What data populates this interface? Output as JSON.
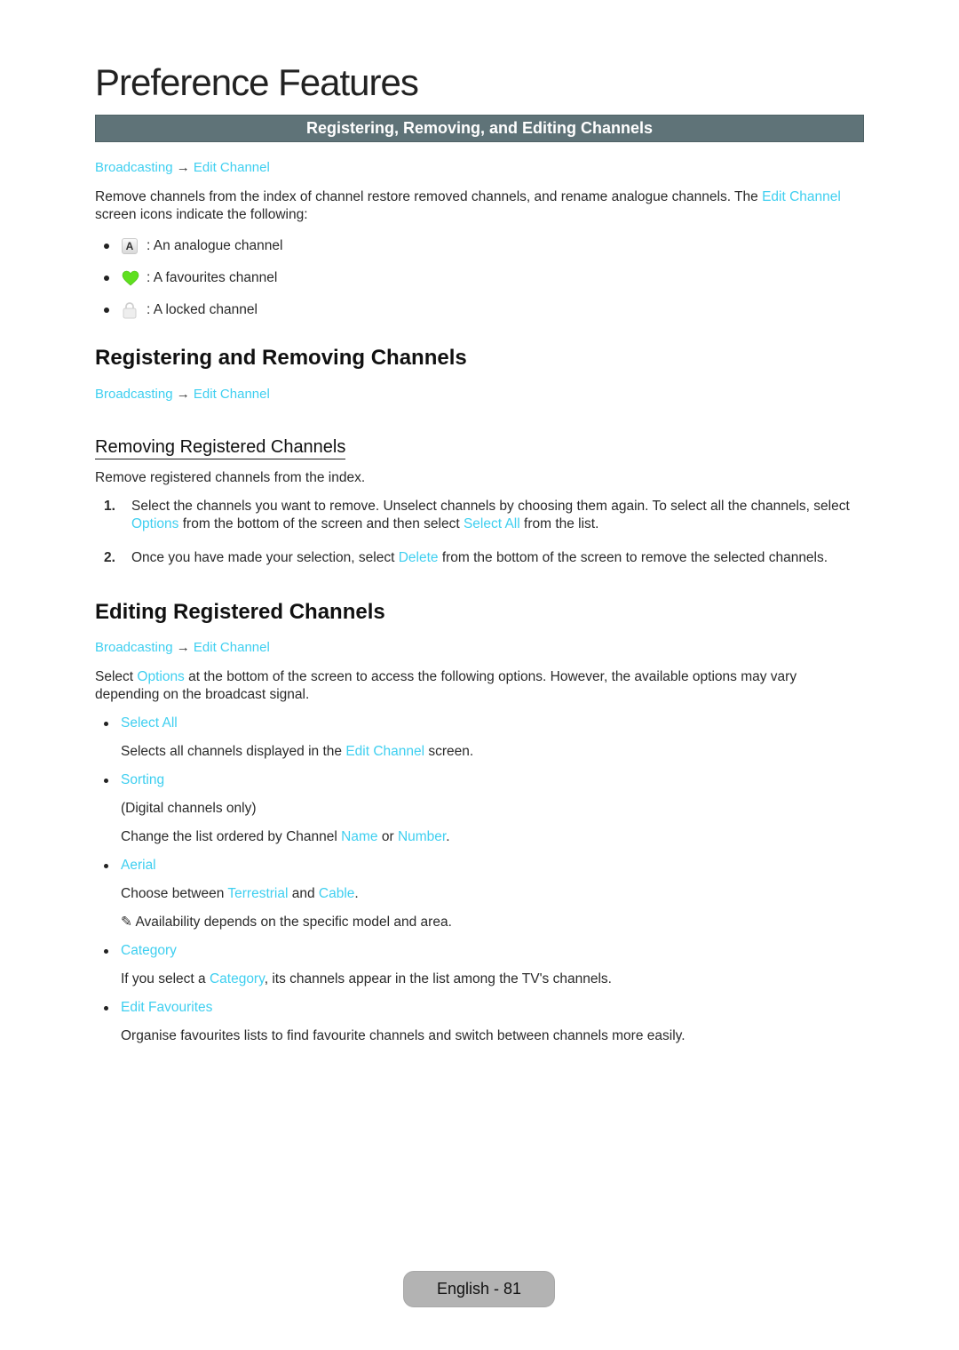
{
  "page_title": "Preference Features",
  "section_bar": "Registering, Removing, and Editing Channels",
  "breadcrumb": {
    "part1": "Broadcasting",
    "arrow": "→",
    "part2": "Edit Channel"
  },
  "intro": {
    "text1": "Remove channels from the index of channel restore removed channels, and rename analogue channels. The ",
    "link": "Edit Channel",
    "text2": " screen icons indicate the following:"
  },
  "icon_legend": [
    {
      "icon": "analogue-icon",
      "glyph": "A",
      "label": ": An analogue channel"
    },
    {
      "icon": "heart-icon",
      "label": ": A favourites channel"
    },
    {
      "icon": "lock-icon",
      "label": ": A locked channel"
    }
  ],
  "section_register": {
    "heading": "Registering and Removing Channels",
    "subheading": "Removing Registered Channels",
    "intro": "Remove registered channels from the index.",
    "steps": [
      {
        "num": "1.",
        "t1": "Select the channels you want to remove. Unselect channels by choosing them again. To select all the channels, select ",
        "l1": "Options",
        "t2": " from the bottom of the screen and then select ",
        "l2": "Select All",
        "t3": " from the list."
      },
      {
        "num": "2.",
        "t1": "Once you have made your selection, select ",
        "l1": "Delete",
        "t2": " from the bottom of the screen to remove the selected channels."
      }
    ]
  },
  "section_edit": {
    "heading": "Editing Registered Channels",
    "intro": {
      "t1": "Select ",
      "l1": "Options",
      "t2": " at the bottom of the screen to access the following options. However, the available options may vary depending on the broadcast signal."
    },
    "options": [
      {
        "label": "Select All",
        "d1": "Selects all channels displayed in the ",
        "dl": "Edit Channel",
        "d2": " screen."
      },
      {
        "label": "Sorting",
        "note": "(Digital channels only)",
        "d1": "Change the list ordered by Channel ",
        "l1": "Name",
        "m": " or ",
        "l2": "Number",
        "d2": "."
      },
      {
        "label": "Aerial",
        "d1": "Choose between ",
        "l1": "Terrestrial",
        "m": " and ",
        "l2": "Cable",
        "d2": ".",
        "memo": "✎ Availability depends on the specific model and area."
      },
      {
        "label": "Category",
        "d1": "If you select a ",
        "dl": "Category",
        "d2": ", its channels appear in the list among the TV's channels."
      },
      {
        "label": "Edit Favourites",
        "d1": "Organise favourites lists to find favourite channels and switch between channels more easily."
      }
    ]
  },
  "footer": "English - 81",
  "colors": {
    "link": "#3fcff0",
    "bar": "#5f7378",
    "footer": "#b3b3b3"
  }
}
